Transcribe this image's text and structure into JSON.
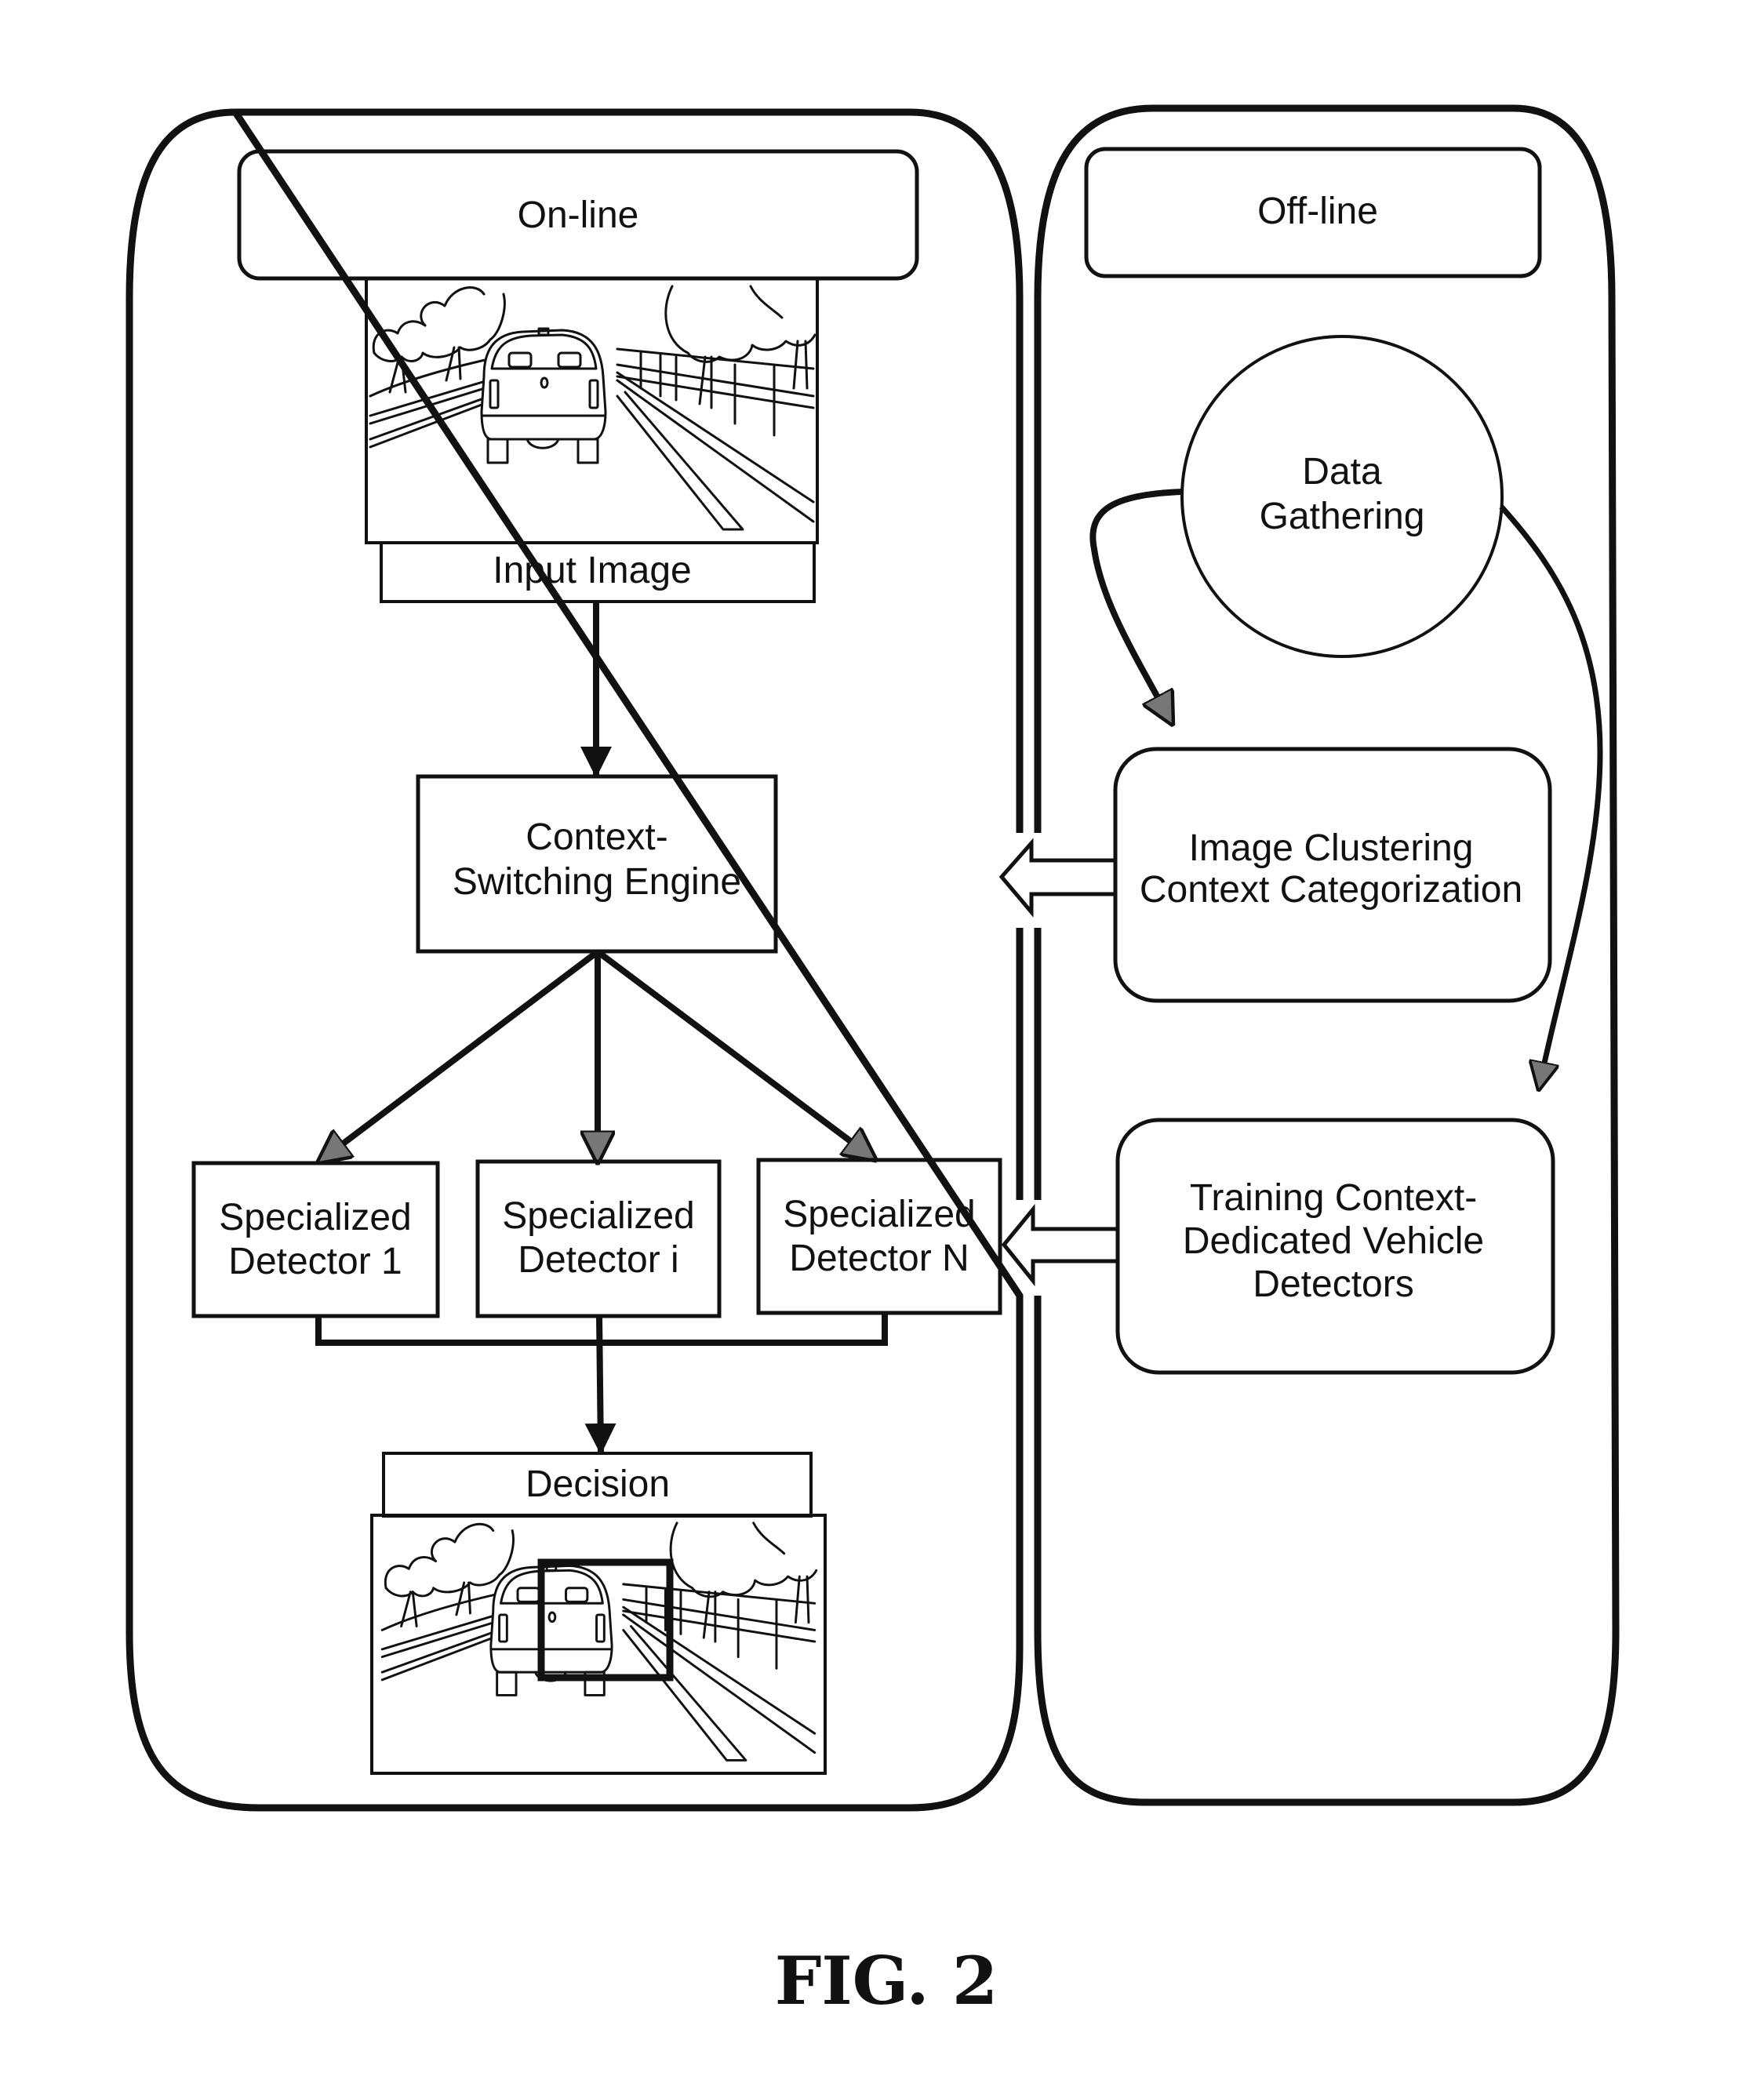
{
  "figure": {
    "caption": "FIG. 2",
    "panels": {
      "online": {
        "title": "On-line",
        "input_image_label": "Input Image",
        "engine": {
          "line1": "Context-",
          "line2": "Switching Engine"
        },
        "detectors": [
          {
            "line1": "Specialized",
            "line2": "Detector 1"
          },
          {
            "line1": "Specialized",
            "line2": "Detector i"
          },
          {
            "line1": "Specialized",
            "line2": "Detector N"
          }
        ],
        "decision_label": "Decision"
      },
      "offline": {
        "title": "Off-line",
        "data_gathering": {
          "line1": "Data",
          "line2": "Gathering"
        },
        "clustering": {
          "line1": "Image Clustering",
          "line2": "Context Categorization"
        },
        "training": {
          "line1": "Training Context-",
          "line2": "Dedicated Vehicle",
          "line3": "Detectors"
        }
      }
    },
    "icons": {
      "road_scene": "road-scene-with-vehicle-illustration",
      "detection_box": "bounding-box-highlight"
    },
    "colors": {
      "ink": "#111111",
      "paper": "#ffffff"
    }
  }
}
